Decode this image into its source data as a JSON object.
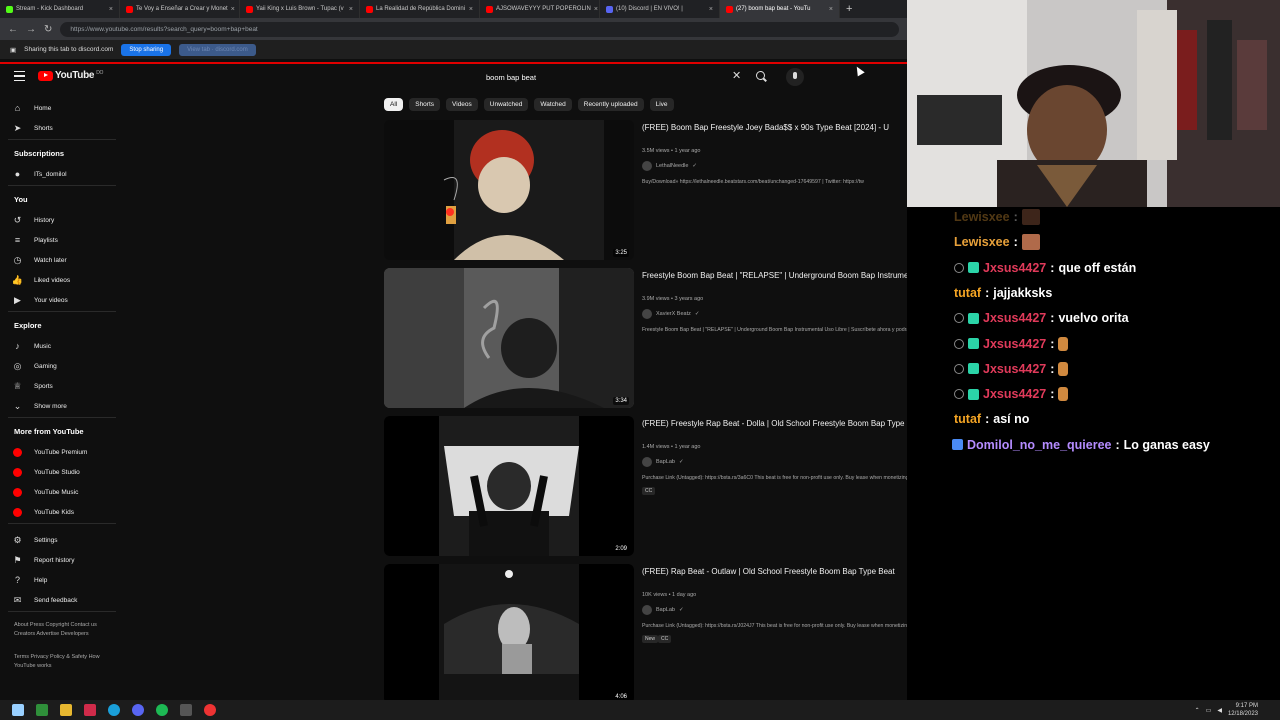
{
  "browser": {
    "tabs": [
      {
        "label": "Stream - Kick Dashboard",
        "color": "#53fc18"
      },
      {
        "label": "Te Voy a Enseñar a Crear y Monet",
        "color": "#ff0000"
      },
      {
        "label": "Yaii King x Luis Brown - Tupac (v",
        "color": "#ff0000"
      },
      {
        "label": "La Realidad de República Domini",
        "color": "#ff0000"
      },
      {
        "label": "AJSOWAVEYYY PUT POPEROLIN",
        "color": "#ff0000"
      },
      {
        "label": "(10) Discord | EN VIVO! |",
        "color": "#5865f2"
      },
      {
        "label": "(27) boom bap beat - YouTu",
        "color": "#ff0000",
        "active": true
      }
    ],
    "url": "https://www.youtube.com/results?search_query=boom+bap+beat",
    "share_text": "Sharing this tab to discord.com",
    "stop_sharing": "Stop sharing",
    "hide_label": "View tab · discord.com"
  },
  "youtube": {
    "logo_text": "YouTube",
    "logo_country": "DO",
    "search_value": "boom bap beat",
    "chips": [
      "All",
      "Shorts",
      "Videos",
      "Unwatched",
      "Watched",
      "Recently uploaded",
      "Live"
    ],
    "sidebar": {
      "main": [
        {
          "label": "Home",
          "icon": "home-icon",
          "glyph": "⌂"
        },
        {
          "label": "Shorts",
          "icon": "shorts-icon",
          "glyph": "➤"
        }
      ],
      "subscriptions_title": "Subscriptions",
      "subscriptions": [
        {
          "label": "ITs_domilol",
          "icon": "channel-avatar-icon",
          "glyph": "●"
        }
      ],
      "you_title": "You",
      "you": [
        {
          "label": "History",
          "icon": "history-icon",
          "glyph": "↺"
        },
        {
          "label": "Playlists",
          "icon": "playlists-icon",
          "glyph": "≡"
        },
        {
          "label": "Watch later",
          "icon": "clock-icon",
          "glyph": "◷"
        },
        {
          "label": "Liked videos",
          "icon": "like-icon",
          "glyph": "👍"
        },
        {
          "label": "Your videos",
          "icon": "your-videos-icon",
          "glyph": "▶"
        }
      ],
      "explore_title": "Explore",
      "explore": [
        {
          "label": "Music",
          "icon": "music-icon",
          "glyph": "♪"
        },
        {
          "label": "Gaming",
          "icon": "gaming-icon",
          "glyph": "◎"
        },
        {
          "label": "Sports",
          "icon": "trophy-icon",
          "glyph": "♕"
        },
        {
          "label": "Show more",
          "icon": "chevron-down-icon",
          "glyph": "⌄"
        }
      ],
      "more_title": "More from YouTube",
      "more": [
        {
          "label": "YouTube Premium",
          "icon": "youtube-premium-icon"
        },
        {
          "label": "YouTube Studio",
          "icon": "youtube-studio-icon"
        },
        {
          "label": "YouTube Music",
          "icon": "youtube-music-icon"
        },
        {
          "label": "YouTube Kids",
          "icon": "youtube-kids-icon"
        }
      ],
      "settings": [
        {
          "label": "Settings",
          "icon": "gear-icon",
          "glyph": "⚙"
        },
        {
          "label": "Report history",
          "icon": "flag-icon",
          "glyph": "⚑"
        },
        {
          "label": "Help",
          "icon": "help-icon",
          "glyph": "?"
        },
        {
          "label": "Send feedback",
          "icon": "feedback-icon",
          "glyph": "✉"
        }
      ],
      "footer1": "About Press Copyright Contact us Creators Advertise Developers",
      "footer2": "Terms Privacy Policy & Safety How YouTube works"
    },
    "results": [
      {
        "title": "(FREE) Boom Bap Freestyle Joey Bada$$ x 90s Type Beat [2024] - U",
        "meta": "3.5M views • 1 year ago",
        "channel": "LethalNeedle",
        "desc": "Buy/Download» https://lethalneedle.beatstars.com/beat/unchanged-17649597 | Twitter: https://tw",
        "duration": "3:25"
      },
      {
        "title": "Freestyle Boom Bap Beat | \"RELAPSE\" | Underground Boom Bap Instrumental Uso Libre |",
        "meta": "3.9M views • 3 years ago",
        "channel": "XavierX Beatz",
        "desc": "Freestyle Boom Bap Beat | \"RELAPSE\" | Underground Boom Bap Instrumental Uso Libre | Suscríbete ahora y podrás encontrar ...",
        "duration": "3:34"
      },
      {
        "title": "(FREE) Freestyle Rap Beat - Dolla | Old School Freestyle Boom Bap Type Beat",
        "meta": "1.4M views • 1 year ago",
        "channel": "BapLab",
        "desc": "Purchase Link (Untagged): https://bsta.rs/3a6C0 This beat is free for non-profit use only. Buy lease when monetizing ...",
        "badges": [
          "CC"
        ],
        "duration": "2:09"
      },
      {
        "title": "(FREE) Rap Beat - Outlaw | Old School Freestyle Boom Bap Type Beat",
        "meta": "10K views • 1 day ago",
        "channel": "BapLab",
        "desc": "Purchase Link (Untagged): https://bsta.rs/J024J7 This beat is free for non-profit use only. Buy lease when monetizing on ...",
        "badges": [
          "New",
          "CC"
        ],
        "duration": "4:06"
      }
    ]
  },
  "chat": [
    {
      "user": "Lewisxee",
      "color": "#e8a13a",
      "msg": "",
      "emote": true
    },
    {
      "user": "Lewisxee",
      "color": "#e8a13a",
      "msg": "",
      "emote": true
    },
    {
      "user": "Jxsus4427",
      "color": "#e03a5a",
      "msg": "que off están",
      "badges": true
    },
    {
      "user": "tutaf",
      "color": "#f5a524",
      "msg": "jajjakksks"
    },
    {
      "user": "Jxsus4427",
      "color": "#e03a5a",
      "msg": "vuelvo orita",
      "badges": true
    },
    {
      "user": "Jxsus4427",
      "color": "#e03a5a",
      "msg": "",
      "badges": true,
      "emote2": true
    },
    {
      "user": "Jxsus4427",
      "color": "#e03a5a",
      "msg": "",
      "badges": true,
      "emote2": true
    },
    {
      "user": "Jxsus4427",
      "color": "#e03a5a",
      "msg": "",
      "badges": true,
      "emote2": true
    },
    {
      "user": "tutaf",
      "color": "#f5a524",
      "msg": "así no"
    },
    {
      "user": "Domilol_no_me_quieree",
      "color": "#b58cff",
      "msg": "Lo ganas easy",
      "badge3": true
    }
  ],
  "taskbar": {
    "clock_time": "9:17 PM",
    "clock_date": "12/18/2023"
  }
}
